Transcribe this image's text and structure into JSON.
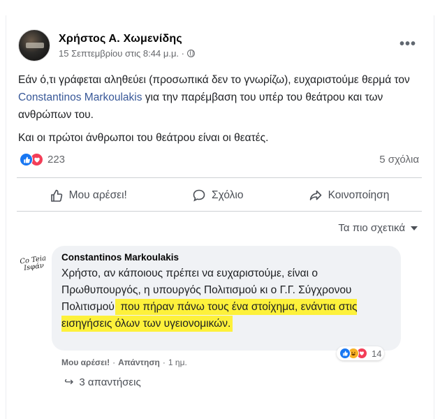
{
  "post": {
    "author": "Χρήστος Α. Χωμενίδης",
    "timestamp": "15 Σεπτεμβρίου στις 8:44 μ.μ. ·",
    "more_icon": "more-horizontal-icon",
    "paragraph1_part1": "Εάν ό,τι γράφεται αληθεύει (προσωπικά δεν το γνωρίζω), ευχαριστούμε θερμά τον ",
    "paragraph1_mention": "Constantinos Markoulakis",
    "paragraph1_part2": " για την παρέμβαση του υπέρ του θεάτρου και των ανθρώπων του.",
    "paragraph2": "Και οι πρώτοι άνθρωποι του θεάτρου είναι οι θεατές.",
    "reaction_count": "223",
    "comments_count": "5 σχόλια"
  },
  "actions": {
    "like": "Μου αρέσει!",
    "comment": "Σχόλιο",
    "share": "Κοινοποίηση"
  },
  "sort": {
    "label": "Τα πιο σχετικά"
  },
  "comment": {
    "avatar_text": "Co Teia Ιsφάν",
    "author": "Constantinos Markoulakis",
    "text_plain": "Χρήστο, αν κάποιους πρέπει να ευχαριστούμε, είναι ο Πρωθυπουργός, η υπουργός Πολιτισμού κι ο Γ.Γ. Σύγχρονου Πολιτισμού,",
    "text_highlight": " που πήραν πάνω τους ένα στοίχημα, ενάντια στις εισηγήσεις όλων των υγειονομικών.",
    "like_label": "Μου αρέσει!",
    "reply_label": "Απάντηση",
    "time": "1 ημ.",
    "reaction_count": "14",
    "replies_label": "3 απαντήσεις"
  },
  "colors": {
    "facebook_blue": "#1877f2",
    "love_red": "#f33e58",
    "highlight_yellow": "#fdf13b",
    "mention_blue": "#385898"
  }
}
